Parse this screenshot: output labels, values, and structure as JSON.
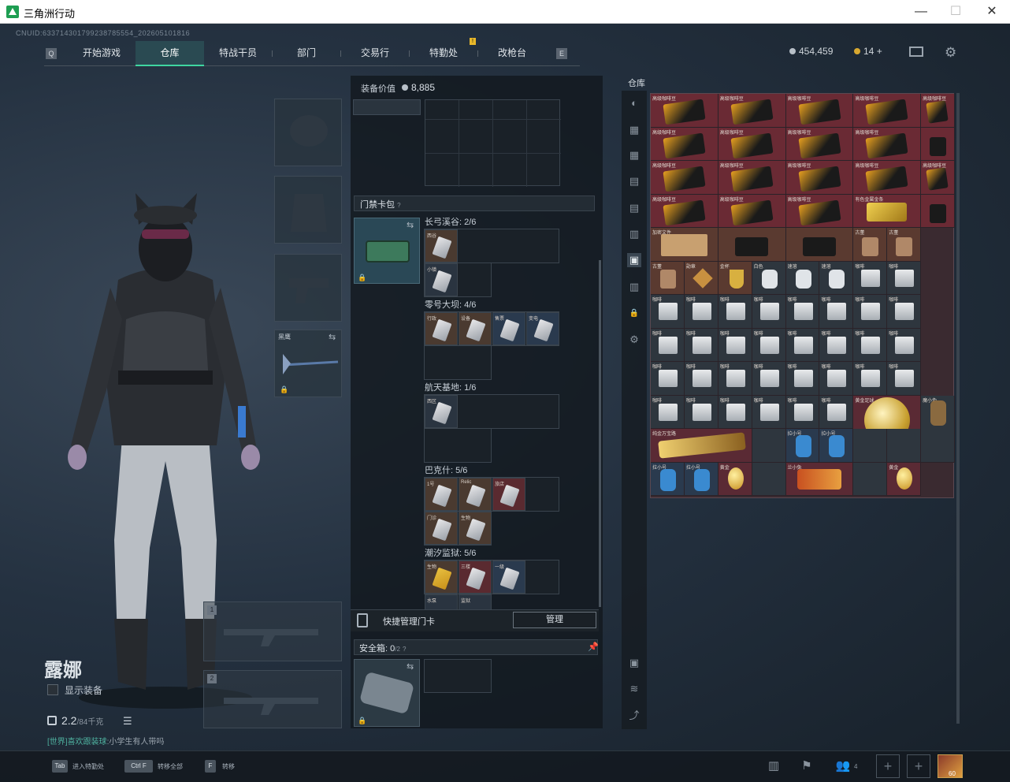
{
  "window": {
    "title": "三角洲行动",
    "minimize": "—",
    "maximize": "☐",
    "close": "✕"
  },
  "uid": "CNUID:633714301799238785554_202605101816",
  "nav": {
    "left_key": "Q",
    "right_key": "E",
    "tabs": [
      "开始游戏",
      "仓库",
      "特战干员",
      "部门",
      "交易行",
      "特勤处",
      "改枪台"
    ],
    "active_tab": "仓库",
    "notif": "!"
  },
  "currency": {
    "coins": "454,459",
    "premium": "14",
    "premium_add": "+"
  },
  "character": {
    "name": "露娜",
    "show_equipment": "显示装备",
    "weight": "2.2",
    "weight_max": "/84千克"
  },
  "chat": {
    "channel": "[世界]",
    "user": "喜欢跟装球",
    "sep": ":",
    "message": "小学生有人带吗"
  },
  "equipment": {
    "melee_label": "黑鹰",
    "slot1": "1",
    "slot2": "2"
  },
  "mid": {
    "equip_value_label": "装备价值",
    "equip_value": "8,885",
    "card_header": "门禁卡包",
    "help": "?",
    "maps": [
      {
        "name": "长弓溪谷: 2/6",
        "cards": [
          "西谷",
          "小镇"
        ]
      },
      {
        "name": "零号大坝: 4/6",
        "cards": [
          "行政",
          "设备",
          "售票",
          "变电"
        ]
      },
      {
        "name": "航天基地: 1/6",
        "cards": [
          "西区"
        ]
      },
      {
        "name": "巴克什: 5/6",
        "cards": [
          "1号",
          "Relic",
          "旅店",
          "门诊",
          "生物"
        ]
      },
      {
        "name": "潮汐监狱: 5/6",
        "cards": [
          "生物",
          "三楼",
          "一级",
          "水泵",
          "监狱"
        ]
      }
    ],
    "quick_manage": "快捷管理门卡",
    "manage_button": "管理",
    "safebox_label": "安全箱:",
    "safebox_count": "0",
    "safebox_max": "/2"
  },
  "warehouse": {
    "title": "仓库",
    "rows": [
      [
        "高级咖啡豆",
        "高级咖啡豆",
        "高级咖啡豆",
        "高级咖啡豆",
        "高级咖啡豆"
      ],
      [
        "高级咖啡豆",
        "高级咖啡豆",
        "高级咖啡豆",
        "高级咖啡豆",
        ""
      ],
      [
        "高级咖啡豆",
        "高级咖啡豆",
        "高级咖啡豆",
        "高级咖啡豆",
        "高级咖啡豆"
      ],
      [
        "高级咖啡豆",
        "高级咖啡豆",
        "高级咖啡豆",
        "有色金属金条",
        ""
      ],
      [
        "加密文件",
        "",
        "",
        "古董",
        "古董"
      ],
      [
        "古董",
        "勋章",
        "金杯",
        "白色",
        "速溶",
        "速溶",
        "咖啡",
        "咖啡"
      ],
      [
        "咖啡",
        "咖啡",
        "咖啡",
        "咖啡",
        "咖啡",
        "咖啡",
        "咖啡",
        "咖啡"
      ],
      [
        "咖啡",
        "咖啡",
        "咖啡",
        "咖啡",
        "咖啡",
        "咖啡",
        "咖啡",
        "咖啡"
      ],
      [
        "咖啡",
        "咖啡",
        "咖啡",
        "咖啡",
        "咖啡",
        "咖啡",
        "咖啡",
        "咖啡"
      ],
      [
        "咖啡",
        "咖啡",
        "咖啡",
        "咖啡",
        "咖啡",
        "咖啡",
        "黄金足球",
        "魔小兔"
      ],
      [
        "纯金万宝路",
        "",
        "拉小号",
        "拉小号",
        "",
        ""
      ],
      [
        "拉小号",
        "拉小号",
        "黄金",
        "",
        "兰小兔",
        "",
        "黄金"
      ]
    ]
  },
  "bottom": {
    "hints": [
      {
        "key": "Tab",
        "label": "进入特勤处"
      },
      {
        "key": "Ctrl F",
        "label": "转移全部"
      },
      {
        "key": "F",
        "label": "转移"
      }
    ],
    "friends": "4",
    "level": "60"
  }
}
